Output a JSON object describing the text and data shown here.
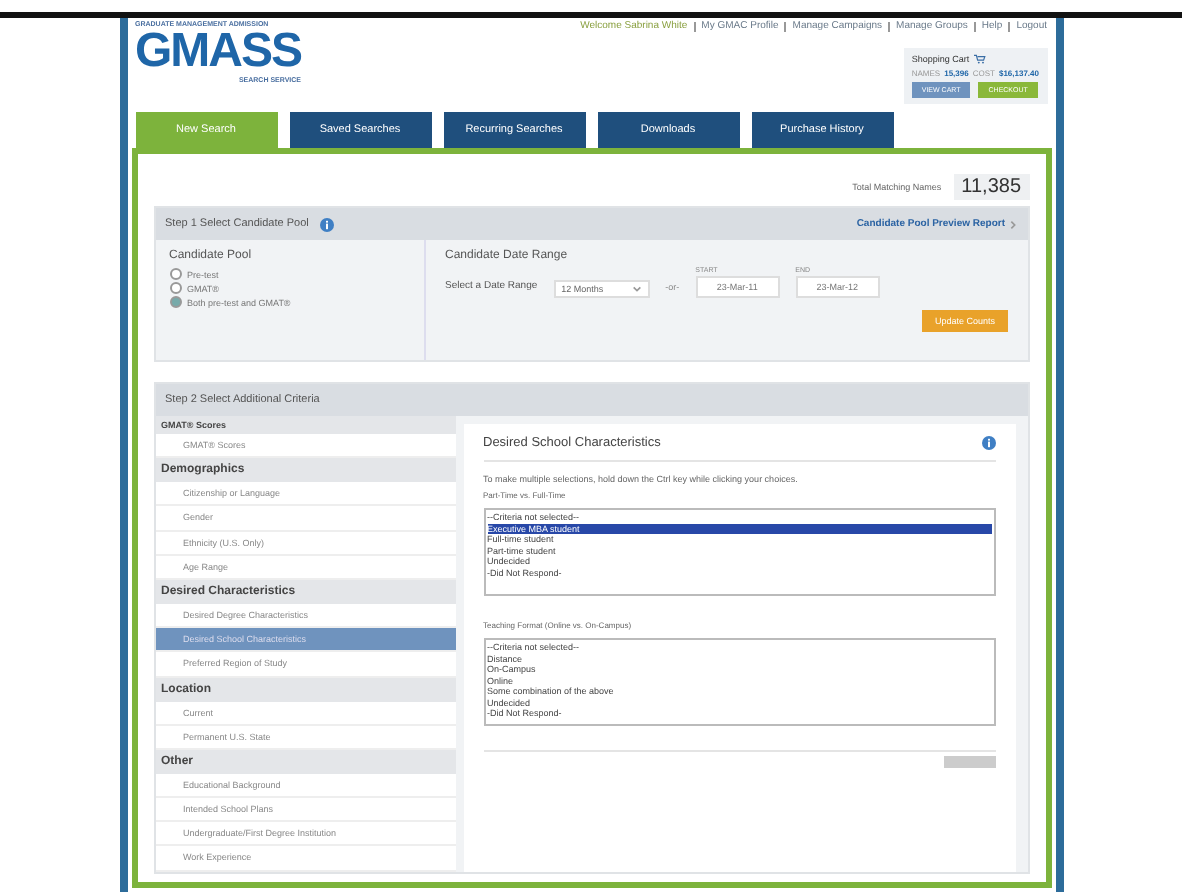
{
  "header": {
    "org": "GRADUATE MANAGEMENT ADMISSION",
    "logo": "GMASS",
    "service": "SEARCH SERVICE",
    "links": [
      "Welcome Sabrina White",
      "My GMAC Profile",
      "Manage Campaigns",
      "Manage Groups",
      "Help",
      "Logout"
    ],
    "cart": {
      "title": "Shopping Cart",
      "names_label": "NAMES",
      "names": "15,396",
      "cost_label": "COST",
      "cost": "$16,137.40",
      "buttons": [
        "VIEW CART",
        "CHECKOUT"
      ]
    }
  },
  "tabs": [
    {
      "label": "New Search",
      "selected": true
    },
    {
      "label": "Saved Searches",
      "selected": false
    },
    {
      "label": "Recurring Searches",
      "selected": false
    },
    {
      "label": "Downloads",
      "selected": false
    },
    {
      "label": "Purchase History",
      "selected": false
    }
  ],
  "total": {
    "label": "Total Matching Names",
    "value": "11,385"
  },
  "step1": {
    "title": "Step 1 Select Candidate Pool",
    "link": "Candidate Pool Preview Report",
    "pool_title": "Candidate Pool",
    "pool": [
      {
        "label": "Pre-test",
        "selected": false
      },
      {
        "label": "GMAT®",
        "selected": false
      },
      {
        "label": "Both pre-test and GMAT®",
        "selected": true
      }
    ],
    "range_title": "Candidate Date Range",
    "range_label": "Select a Date Range",
    "range_value": "12 Months",
    "or": "-or-",
    "start_label": "START",
    "start": "23-Mar-11",
    "end_label": "END",
    "end": "23-Mar-12",
    "update": "Update Counts"
  },
  "step2": {
    "title": "Step 2 Select Additional Criteria",
    "groups": [
      {
        "title": "GMAT® Scores",
        "items": [
          {
            "label": "GMAT® Scores",
            "selected": false
          }
        ]
      },
      {
        "title": "Demographics",
        "items": [
          {
            "label": "Citizenship or Language",
            "selected": false
          },
          {
            "label": "Gender",
            "selected": false
          },
          {
            "label": "Ethnicity (U.S. Only)",
            "selected": false
          },
          {
            "label": "Age Range",
            "selected": false
          }
        ]
      },
      {
        "title": "Desired Characteristics",
        "items": [
          {
            "label": "Desired Degree Characteristics",
            "selected": false
          },
          {
            "label": "Desired School Characteristics",
            "selected": true
          },
          {
            "label": "Preferred Region of Study",
            "selected": false
          }
        ]
      },
      {
        "title": "Location",
        "items": [
          {
            "label": "Current",
            "selected": false
          },
          {
            "label": "Permanent U.S. State",
            "selected": false
          }
        ]
      },
      {
        "title": "Other",
        "items": [
          {
            "label": "Educational Background",
            "selected": false
          },
          {
            "label": "Intended School Plans",
            "selected": false
          },
          {
            "label": "Undergraduate/First Degree Institution",
            "selected": false
          },
          {
            "label": "Work Experience",
            "selected": false
          }
        ]
      }
    ],
    "detail": {
      "title": "Desired School Characteristics",
      "hint": "To make multiple selections, hold down the Ctrl key while clicking your choices.",
      "lists": [
        {
          "label": "Part-Time vs. Full-Time",
          "options": [
            {
              "label": "--Criteria not selected--",
              "selected": false
            },
            {
              "label": "Executive MBA student",
              "selected": true
            },
            {
              "label": "Full-time student",
              "selected": false
            },
            {
              "label": "Part-time student",
              "selected": false
            },
            {
              "label": "Undecided",
              "selected": false
            },
            {
              "label": "-Did Not Respond-",
              "selected": false
            }
          ]
        },
        {
          "label": "Teaching Format (Online vs. On-Campus)",
          "options": [
            {
              "label": "--Criteria not selected--",
              "selected": false
            },
            {
              "label": "Distance",
              "selected": false
            },
            {
              "label": "On-Campus",
              "selected": false
            },
            {
              "label": "Online",
              "selected": false
            },
            {
              "label": "Some combination of the above",
              "selected": false
            },
            {
              "label": "Undecided",
              "selected": false
            },
            {
              "label": "-Did Not Respond-",
              "selected": false
            }
          ]
        }
      ]
    }
  }
}
